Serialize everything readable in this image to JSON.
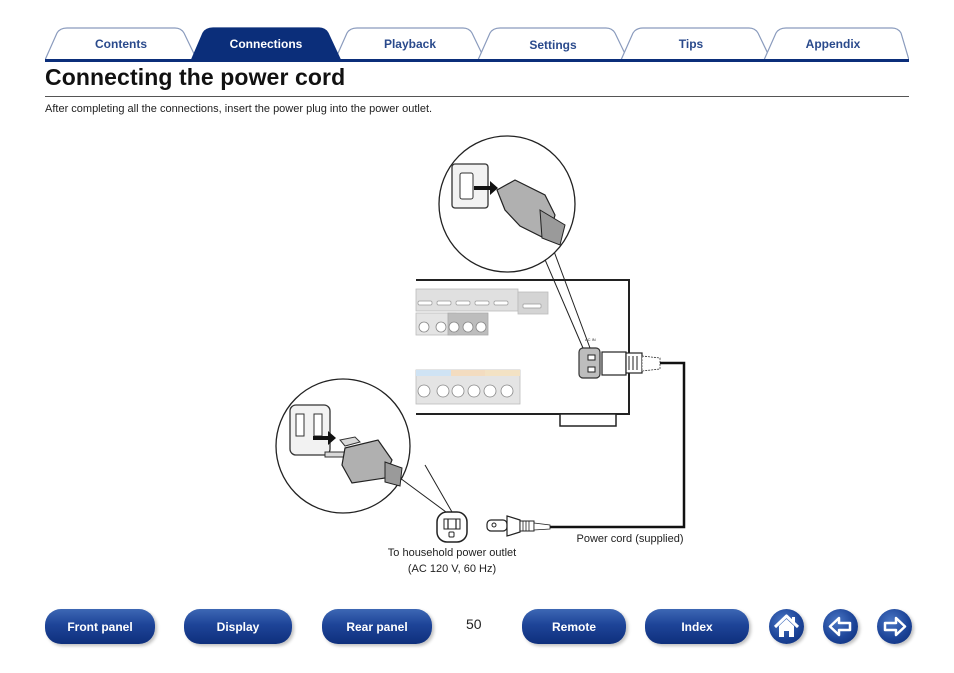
{
  "tabs": [
    {
      "label": "Contents",
      "active": false
    },
    {
      "label": "Connections",
      "active": true
    },
    {
      "label": "Playback",
      "active": false
    },
    {
      "label": "Settings",
      "active": false
    },
    {
      "label": "Tips",
      "active": false
    },
    {
      "label": "Appendix",
      "active": false
    }
  ],
  "header": {
    "title": "Connecting the power cord",
    "intro": "After completing all the connections, insert the power plug into the power outlet."
  },
  "diagram": {
    "outlet_label_line1": "To household power outlet",
    "outlet_label_line2": "(AC 120 V, 60 Hz)",
    "cord_label": "Power cord (supplied)",
    "inlet_marking": "AC IN"
  },
  "footer": {
    "buttons": [
      {
        "label": "Front panel"
      },
      {
        "label": "Display"
      },
      {
        "label": "Rear panel"
      },
      {
        "label": "Remote"
      },
      {
        "label": "Index"
      }
    ],
    "page_number": "50",
    "icons": [
      "home-icon",
      "back-arrow-icon",
      "forward-arrow-icon"
    ]
  },
  "colors": {
    "accent": "#0b2e7a",
    "tab_text": "#2a4a8c",
    "button_dark": "#0e2f7c",
    "button_light": "#3d67b4"
  }
}
